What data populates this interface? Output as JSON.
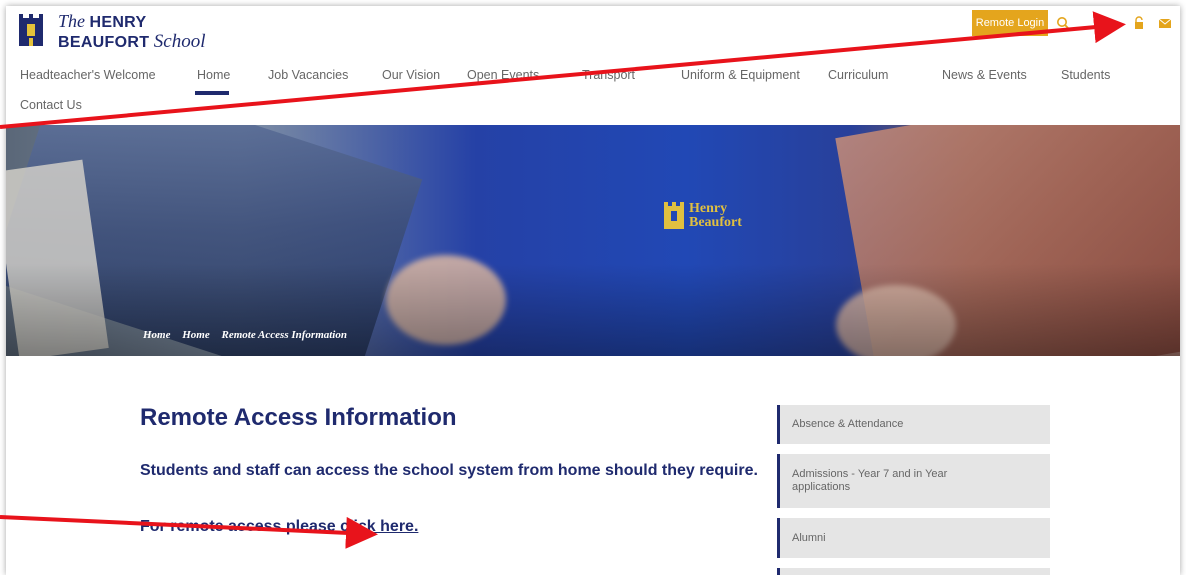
{
  "logo": {
    "line1_italic": "The",
    "line1_bold": "HENRY",
    "line2_bold": "BEAUFORT",
    "line2_italic": "School"
  },
  "header": {
    "remote_login": "Remote Login"
  },
  "nav": [
    {
      "label": "Headteacher's Welcome"
    },
    {
      "label": "Home"
    },
    {
      "label": "Job Vacancies"
    },
    {
      "label": "Our Vision"
    },
    {
      "label": "Open Events"
    },
    {
      "label": "Transport"
    },
    {
      "label": "Uniform & Equipment"
    },
    {
      "label": "Curriculum"
    },
    {
      "label": "News & Events"
    },
    {
      "label": "Students"
    },
    {
      "label": "Contact Us"
    }
  ],
  "hero": {
    "badge_line1": "Henry",
    "badge_line2": "Beaufort",
    "breadcrumbs": [
      "Home",
      "Home",
      "Remote Access Information"
    ]
  },
  "content": {
    "title": "Remote Access Information",
    "subtitle": "Students and staff can access the school system from home should they require.",
    "remote_prefix": "For remote access please ",
    "remote_link": "click here."
  },
  "sidebar": [
    {
      "label": "Absence & Attendance"
    },
    {
      "label": "Admissions - Year 7 and in Year applications"
    },
    {
      "label": "Alumni"
    }
  ],
  "colors": {
    "brand_navy": "#1f2a6e",
    "accent_gold": "#e4a51d",
    "annotation_red": "#e8131b"
  },
  "icons": {
    "search": "search-icon",
    "lock": "lock-icon",
    "mail": "mail-icon"
  }
}
